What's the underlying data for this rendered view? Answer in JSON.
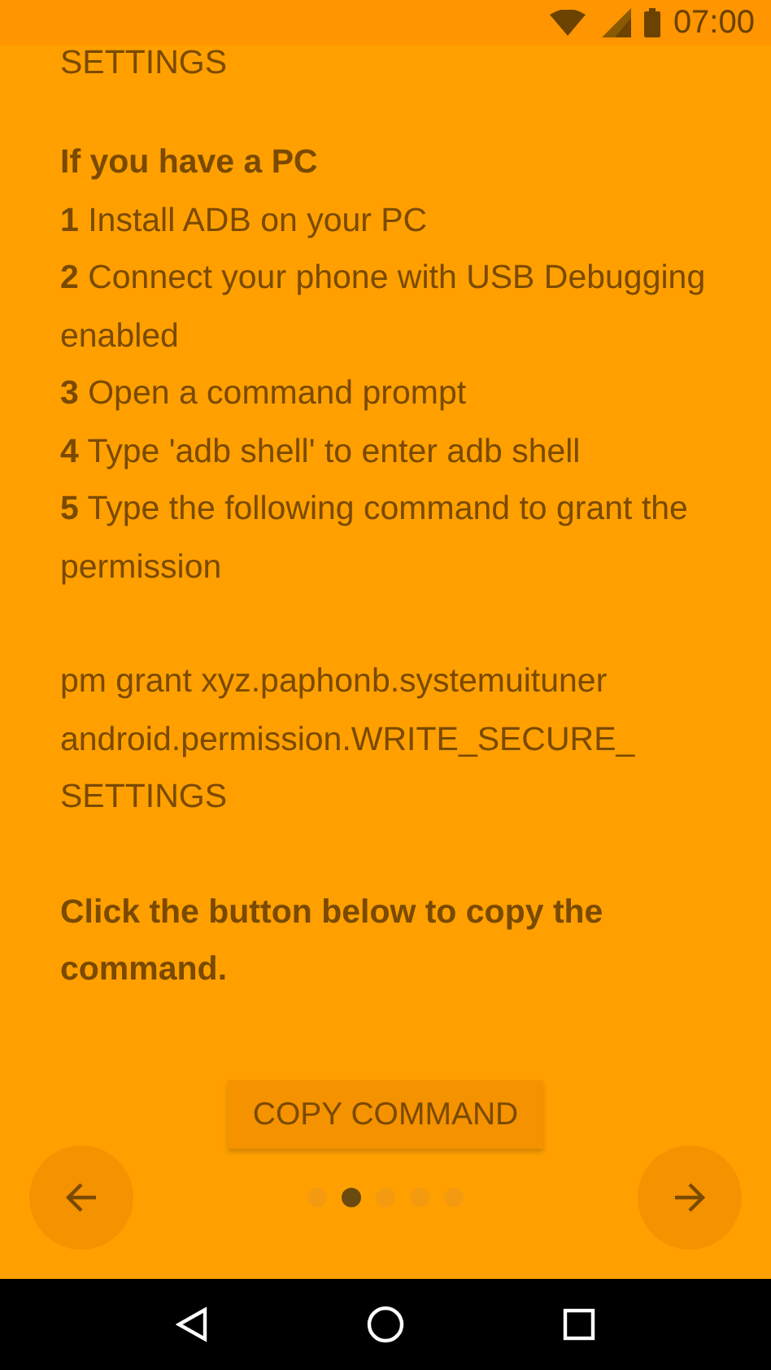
{
  "status_bar": {
    "time": "07:00"
  },
  "content": {
    "cut_heading": "SETTINGS",
    "section_title": "If you have a PC",
    "steps": [
      "**1** Install ADB on your PC",
      "**2** Connect your phone with USB Debugging enabled",
      "**3** Open a command prompt",
      "**4** Type 'adb shell' to enter adb shell",
      "**5** Type the following command to grant the permission"
    ],
    "command_lines": [
      "pm grant xyz.paphonb.systemuituner",
      "android.permission.WRITE_SECURE_",
      "SETTINGS"
    ],
    "instruction": "Click the button below to copy the command.",
    "button": "COPY COMMAND"
  },
  "pager": {
    "dots": [
      {
        "selected": false
      },
      {
        "selected": true
      },
      {
        "selected": false
      },
      {
        "selected": false
      },
      {
        "selected": false
      }
    ]
  }
}
